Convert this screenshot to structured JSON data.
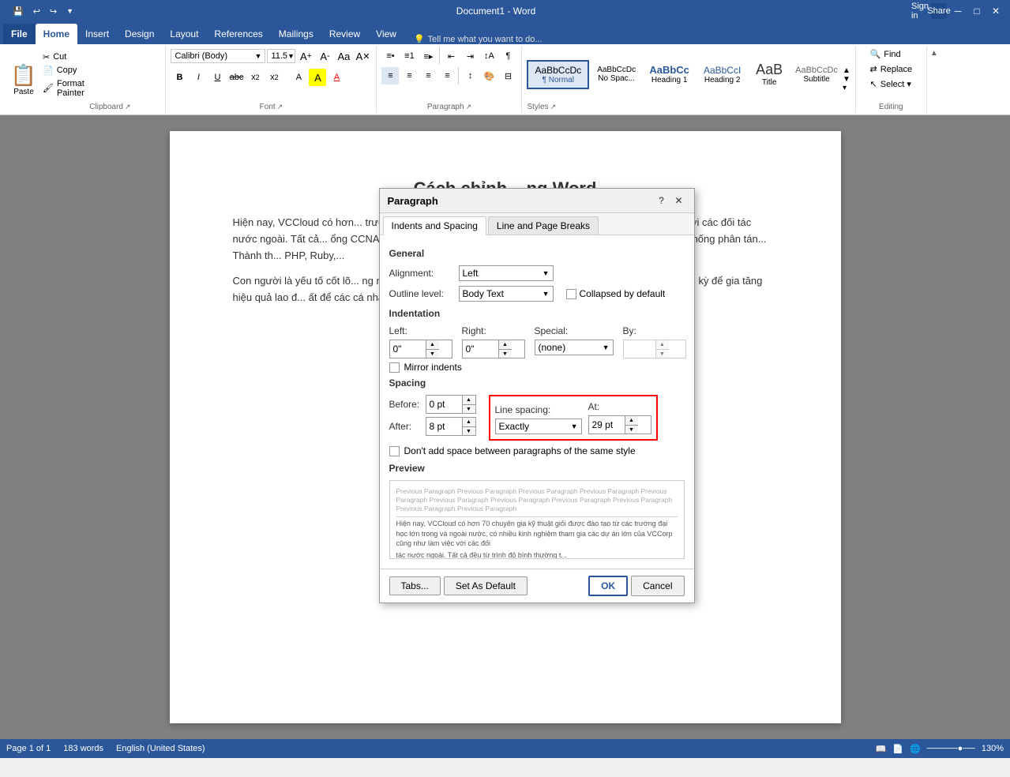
{
  "titlebar": {
    "title": "Document1 - Word",
    "qat": [
      "💾",
      "↩",
      "↪",
      "▼"
    ],
    "controls": [
      "─",
      "□",
      "✕"
    ]
  },
  "ribbon_tabs": [
    {
      "label": "File",
      "active": false
    },
    {
      "label": "Home",
      "active": true
    },
    {
      "label": "Insert",
      "active": false
    },
    {
      "label": "Design",
      "active": false
    },
    {
      "label": "Layout",
      "active": false
    },
    {
      "label": "References",
      "active": false
    },
    {
      "label": "Mailings",
      "active": false
    },
    {
      "label": "Review",
      "active": false
    },
    {
      "label": "View",
      "active": false
    }
  ],
  "ribbon": {
    "clipboard": {
      "label": "Clipboard",
      "paste_label": "Paste",
      "cut_label": "Cut",
      "copy_label": "Copy",
      "format_painter_label": "Format Painter"
    },
    "font": {
      "label": "Font",
      "font_name": "Calibri (Body)",
      "font_size": "11.5",
      "bold": "B",
      "italic": "I",
      "underline": "U",
      "strikethrough": "abc",
      "subscript": "x₂",
      "superscript": "x²",
      "text_color": "A",
      "highlight": "A",
      "font_color_marker": "A"
    },
    "paragraph": {
      "label": "Paragraph"
    },
    "styles": {
      "label": "Styles",
      "items": [
        {
          "label": "Normal",
          "class": "style-normal",
          "active": true
        },
        {
          "label": "No Spac...",
          "class": "style-no-spacing"
        },
        {
          "label": "Heading 1",
          "class": "style-h1"
        },
        {
          "label": "Heading 2",
          "class": "style-h2"
        },
        {
          "label": "Title",
          "class": "style-title"
        },
        {
          "label": "Subtitle",
          "class": "style-subtitle"
        }
      ]
    },
    "editing": {
      "label": "Editing",
      "find_label": "Find",
      "replace_label": "Replace",
      "select_label": "Select ▾"
    }
  },
  "tell_me": {
    "placeholder": "Tell me what you want to do..."
  },
  "signin": "Sign in",
  "share": "Share",
  "document": {
    "title": "Cách chỉnh... ng Word",
    "para1": "Hiện nay, VCCloud có hơn... trường đại học lớn trong và ngoài nước, có nhiều k... ng như làm việc với các đối tác nước ngoài. Tất cả... ổng CCNA, Bảo mật hệ thống mạng CEH, Kỹ sư an... Performance) và các hệ thống phân tán... Thành th... PHP, Ruby,...",
    "para2": "Con người là yếu tố cốt lõ... ng nhân tài là chiến lược lâu dài của công ty, VCClo... cho nhân viên định kỳ để gia tăng hiệu quả lao đ... ất để các cá nhân phát huy được hết khả năng cử..."
  },
  "paragraph_dialog": {
    "title": "Paragraph",
    "tabs": [
      {
        "label": "Indents and Spacing",
        "active": true
      },
      {
        "label": "Line and Page Breaks",
        "active": false
      }
    ],
    "general": {
      "label": "General",
      "alignment_label": "Alignment:",
      "alignment_value": "Left",
      "outline_label": "Outline level:",
      "outline_value": "Body Text",
      "collapsed_label": "Collapsed by default"
    },
    "indentation": {
      "label": "Indentation",
      "left_label": "Left:",
      "left_value": "0\"",
      "right_label": "Right:",
      "right_value": "0\"",
      "special_label": "Special:",
      "special_value": "(none)",
      "by_label": "By:",
      "by_value": "",
      "mirror_label": "Mirror indents"
    },
    "spacing": {
      "label": "Spacing",
      "before_label": "Before:",
      "before_value": "0 pt",
      "after_label": "After:",
      "after_value": "8 pt",
      "line_spacing_label": "Line spacing:",
      "line_spacing_value": "Exactly",
      "at_label": "At:",
      "at_value": "29 pt",
      "dont_add_label": "Don't add space between paragraphs of the same style"
    },
    "preview": {
      "label": "Preview",
      "prev_text": "Previous Paragraph Previous Paragraph Previous Paragraph Previous Paragraph Previous Paragraph Previous Paragraph Previous Paragraph Previous Paragraph Previous Paragraph Previous Paragraph Previous Paragraph",
      "current_text": "Hiện nay, VCCloud có hơn 70 chuyên gia kỹ thuật giỏi được đào tạo từ các trường đại học lớn trong và ngoài nước, có nhiều kinh nghiệm tham gia các dự án lớn của VCCorp cũng như làm việc với các đối",
      "next_text": "tác nước ngoài. Tất cả đều từ trình độ bình thường t..."
    },
    "buttons": {
      "tabs_btn": "Tabs...",
      "set_default_btn": "Set As Default",
      "ok_btn": "OK",
      "cancel_btn": "Cancel"
    }
  },
  "status_bar": {
    "page": "Page 1 of 1",
    "words": "183 words",
    "language": "English (United States)",
    "zoom": "130%"
  }
}
